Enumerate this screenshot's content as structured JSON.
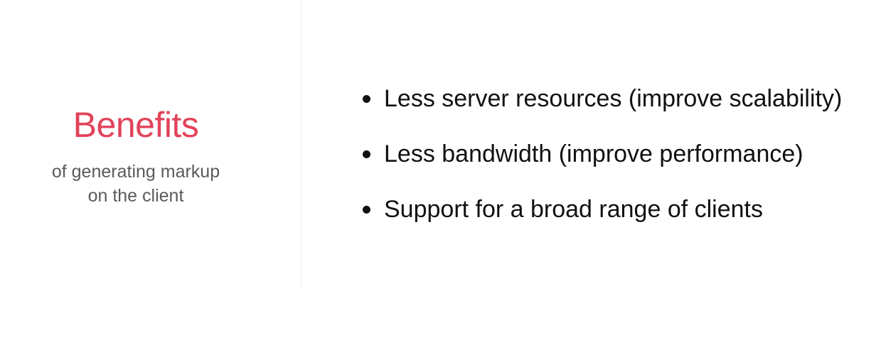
{
  "heading": {
    "title": "Benefits",
    "subtitle_line1": "of generating markup",
    "subtitle_line2": "on the client"
  },
  "bullets": [
    "Less server resources (improve scalability)",
    "Less bandwidth (improve performance)",
    "Support for a broad range of clients"
  ],
  "colors": {
    "title": "#e2435a",
    "subtitle": "#5a5a5a",
    "body_text": "#111111",
    "divider": "#ececec",
    "background": "#ffffff"
  }
}
